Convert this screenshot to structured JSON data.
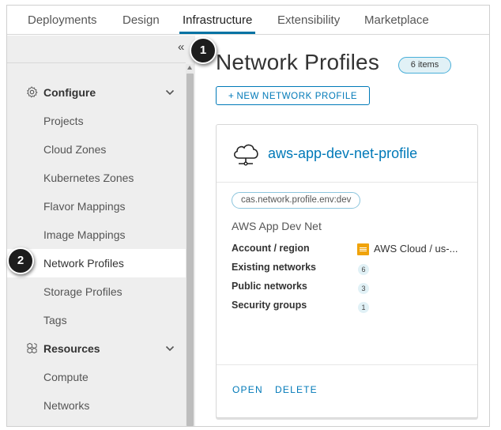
{
  "top_nav": {
    "tabs": [
      {
        "label": "Deployments",
        "active": false
      },
      {
        "label": "Design",
        "active": false
      },
      {
        "label": "Infrastructure",
        "active": true
      },
      {
        "label": "Extensibility",
        "active": false
      },
      {
        "label": "Marketplace",
        "active": false
      }
    ]
  },
  "sidebar": {
    "collapse_glyph": "«",
    "configure": {
      "label": "Configure",
      "icon": "gear-icon",
      "expanded": true,
      "items": [
        {
          "label": "Projects",
          "active": false
        },
        {
          "label": "Cloud Zones",
          "active": false
        },
        {
          "label": "Kubernetes Zones",
          "active": false
        },
        {
          "label": "Flavor Mappings",
          "active": false
        },
        {
          "label": "Image Mappings",
          "active": false
        },
        {
          "label": "Network Profiles",
          "active": true
        },
        {
          "label": "Storage Profiles",
          "active": false
        },
        {
          "label": "Tags",
          "active": false
        }
      ]
    },
    "resources": {
      "label": "Resources",
      "icon": "boxes-icon",
      "expanded": true,
      "items": [
        {
          "label": "Compute",
          "active": false
        },
        {
          "label": "Networks",
          "active": false
        }
      ]
    }
  },
  "callouts": [
    "1",
    "2"
  ],
  "main": {
    "title": "Network Profiles",
    "count_badge": "6 items",
    "new_button": {
      "plus": "+",
      "label": "NEW NETWORK PROFILE"
    }
  },
  "card": {
    "icon": "cloud-network-icon",
    "title": "aws-app-dev-net-profile",
    "tag": "cas.network.profile.env:dev",
    "description": "AWS App Dev Net",
    "rows": {
      "account_region": {
        "label": "Account / region",
        "value": "AWS Cloud / us-..."
      },
      "existing_networks": {
        "label": "Existing networks",
        "value": "6"
      },
      "public_networks": {
        "label": "Public networks",
        "value": "3"
      },
      "security_groups": {
        "label": "Security groups",
        "value": "1"
      }
    },
    "actions": {
      "open": "OPEN",
      "delete": "DELETE"
    }
  },
  "colors": {
    "accent": "#0079b8",
    "nav_underline": "#0072a3",
    "sidebar_bg": "#eeeeee",
    "badge_bg": "#e1f1f6",
    "aws_orange": "#f0a30a",
    "callout_bg": "#1d1d1d"
  }
}
